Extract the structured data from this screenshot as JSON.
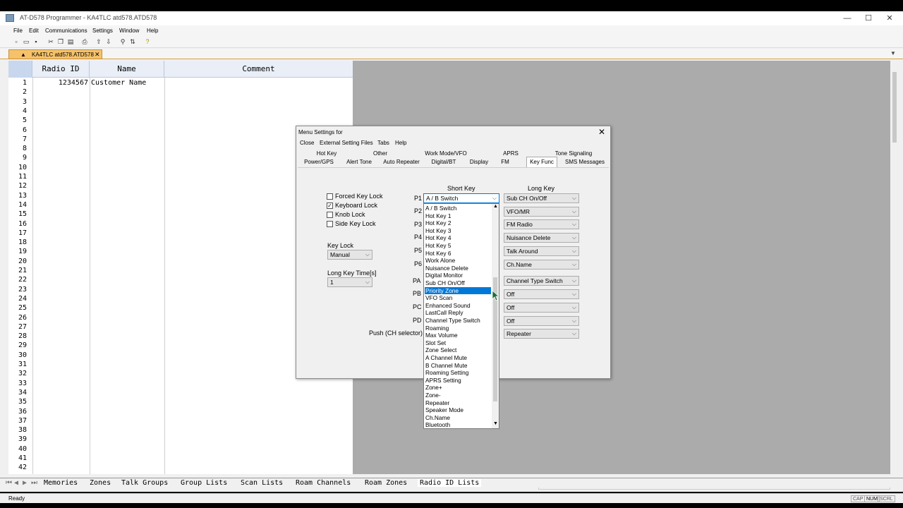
{
  "window": {
    "title": "AT-D578 Programmer - KA4TLC atd578.ATD578",
    "minimize": "—",
    "maximize": "☐",
    "close": "✕"
  },
  "menu": [
    "File",
    "Edit",
    "Communications",
    "Settings",
    "Window",
    "Help"
  ],
  "doc_tab": {
    "label": "KA4TLC atd578.ATD578",
    "close": "✕"
  },
  "grid": {
    "headers": [
      "Radio ID",
      "Name",
      "Comment"
    ],
    "rows": [
      {
        "num": "1",
        "id": "1234567",
        "name": "Customer Name"
      },
      {
        "num": "2"
      },
      {
        "num": "3"
      },
      {
        "num": "4"
      },
      {
        "num": "5"
      },
      {
        "num": "6"
      },
      {
        "num": "7"
      },
      {
        "num": "8"
      },
      {
        "num": "9"
      },
      {
        "num": "10"
      },
      {
        "num": "11"
      },
      {
        "num": "12"
      },
      {
        "num": "13"
      },
      {
        "num": "14"
      },
      {
        "num": "15"
      },
      {
        "num": "16"
      },
      {
        "num": "17"
      },
      {
        "num": "18"
      },
      {
        "num": "19"
      },
      {
        "num": "20"
      },
      {
        "num": "21"
      },
      {
        "num": "22"
      },
      {
        "num": "23"
      },
      {
        "num": "24"
      },
      {
        "num": "25"
      },
      {
        "num": "26"
      },
      {
        "num": "27"
      },
      {
        "num": "28"
      },
      {
        "num": "29"
      },
      {
        "num": "30"
      },
      {
        "num": "31"
      },
      {
        "num": "32"
      },
      {
        "num": "33"
      },
      {
        "num": "34"
      },
      {
        "num": "35"
      },
      {
        "num": "36"
      },
      {
        "num": "37"
      },
      {
        "num": "38"
      },
      {
        "num": "39"
      },
      {
        "num": "40"
      },
      {
        "num": "41"
      },
      {
        "num": "42"
      }
    ]
  },
  "dialog": {
    "title": "Menu Settings for",
    "close": "✕",
    "menu": [
      "Close",
      "External Setting Files",
      "Tabs",
      "Help"
    ],
    "tabs_row1": [
      "Hot Key",
      "Other",
      "Work Mode/VFO",
      "APRS",
      "Tone Signaling"
    ],
    "tabs_row2": [
      "Power/GPS",
      "Alert Tone",
      "Auto Repeater",
      "Digital/BT",
      "Display",
      "FM",
      "Key Func",
      "SMS Messages"
    ],
    "active_tab": "Key Func",
    "checkboxes": [
      {
        "label": "Forced Key Lock",
        "checked": false
      },
      {
        "label": "Keyboard Lock",
        "checked": true
      },
      {
        "label": "Knob Lock",
        "checked": false
      },
      {
        "label": "Side Key Lock",
        "checked": false
      }
    ],
    "check_mark": "✓",
    "key_lock_label": "Key Lock",
    "key_lock_value": "Manual",
    "long_key_time_label": "Long Key Time[s]",
    "long_key_time_value": "1",
    "short_key_header": "Short Key",
    "long_key_header": "Long Key",
    "keys": [
      "P1",
      "P2",
      "P3",
      "P4",
      "P5",
      "P6",
      "PA",
      "PB",
      "PC",
      "PD",
      "Push (CH selector)"
    ],
    "short_p1": "A / B Switch",
    "long_values": [
      "Sub CH On/Off",
      "VFO/MR",
      "FM Radio",
      "Nuisance Delete",
      "Talk Around",
      "Ch.Name",
      "Channel Type Switch",
      "Off",
      "Off",
      "Off",
      "Repeater"
    ]
  },
  "dropdown": {
    "items": [
      "A / B Switch",
      "Hot Key 1",
      "Hot Key 2",
      "Hot Key 3",
      "Hot Key 4",
      "Hot Key 5",
      "Hot Key 6",
      "Work Alone",
      "Nuisance Delete",
      "Digital Monitor",
      "Sub CH On/Off",
      "Priority Zone",
      "VFO Scan",
      "Enhanced Sound",
      "LastCall Reply",
      "Channel Type Switch",
      "Roaming",
      "Max Volume",
      "Slot Set",
      "Zone Select",
      "A Channel Mute",
      "B Channel Mute",
      "Roaming Setting",
      "APRS Setting",
      "Zone+",
      "Zone-",
      "Repeater",
      "Speaker Mode",
      "Ch.Name",
      "Bluetooth"
    ],
    "selected": "Priority Zone"
  },
  "sheet_tabs": [
    "Memories",
    "Zones",
    "Talk Groups",
    "Group Lists",
    "Scan Lists",
    "Roam Channels",
    "Roam Zones",
    "Radio ID Lists"
  ],
  "active_sheet": "Radio ID Lists",
  "status": {
    "text": "Ready",
    "caps": "CAP",
    "num": "NUM",
    "scrl": "SCRL"
  },
  "colors": {
    "selection": "#0078d7",
    "doc_tab": "#f5c26b"
  }
}
